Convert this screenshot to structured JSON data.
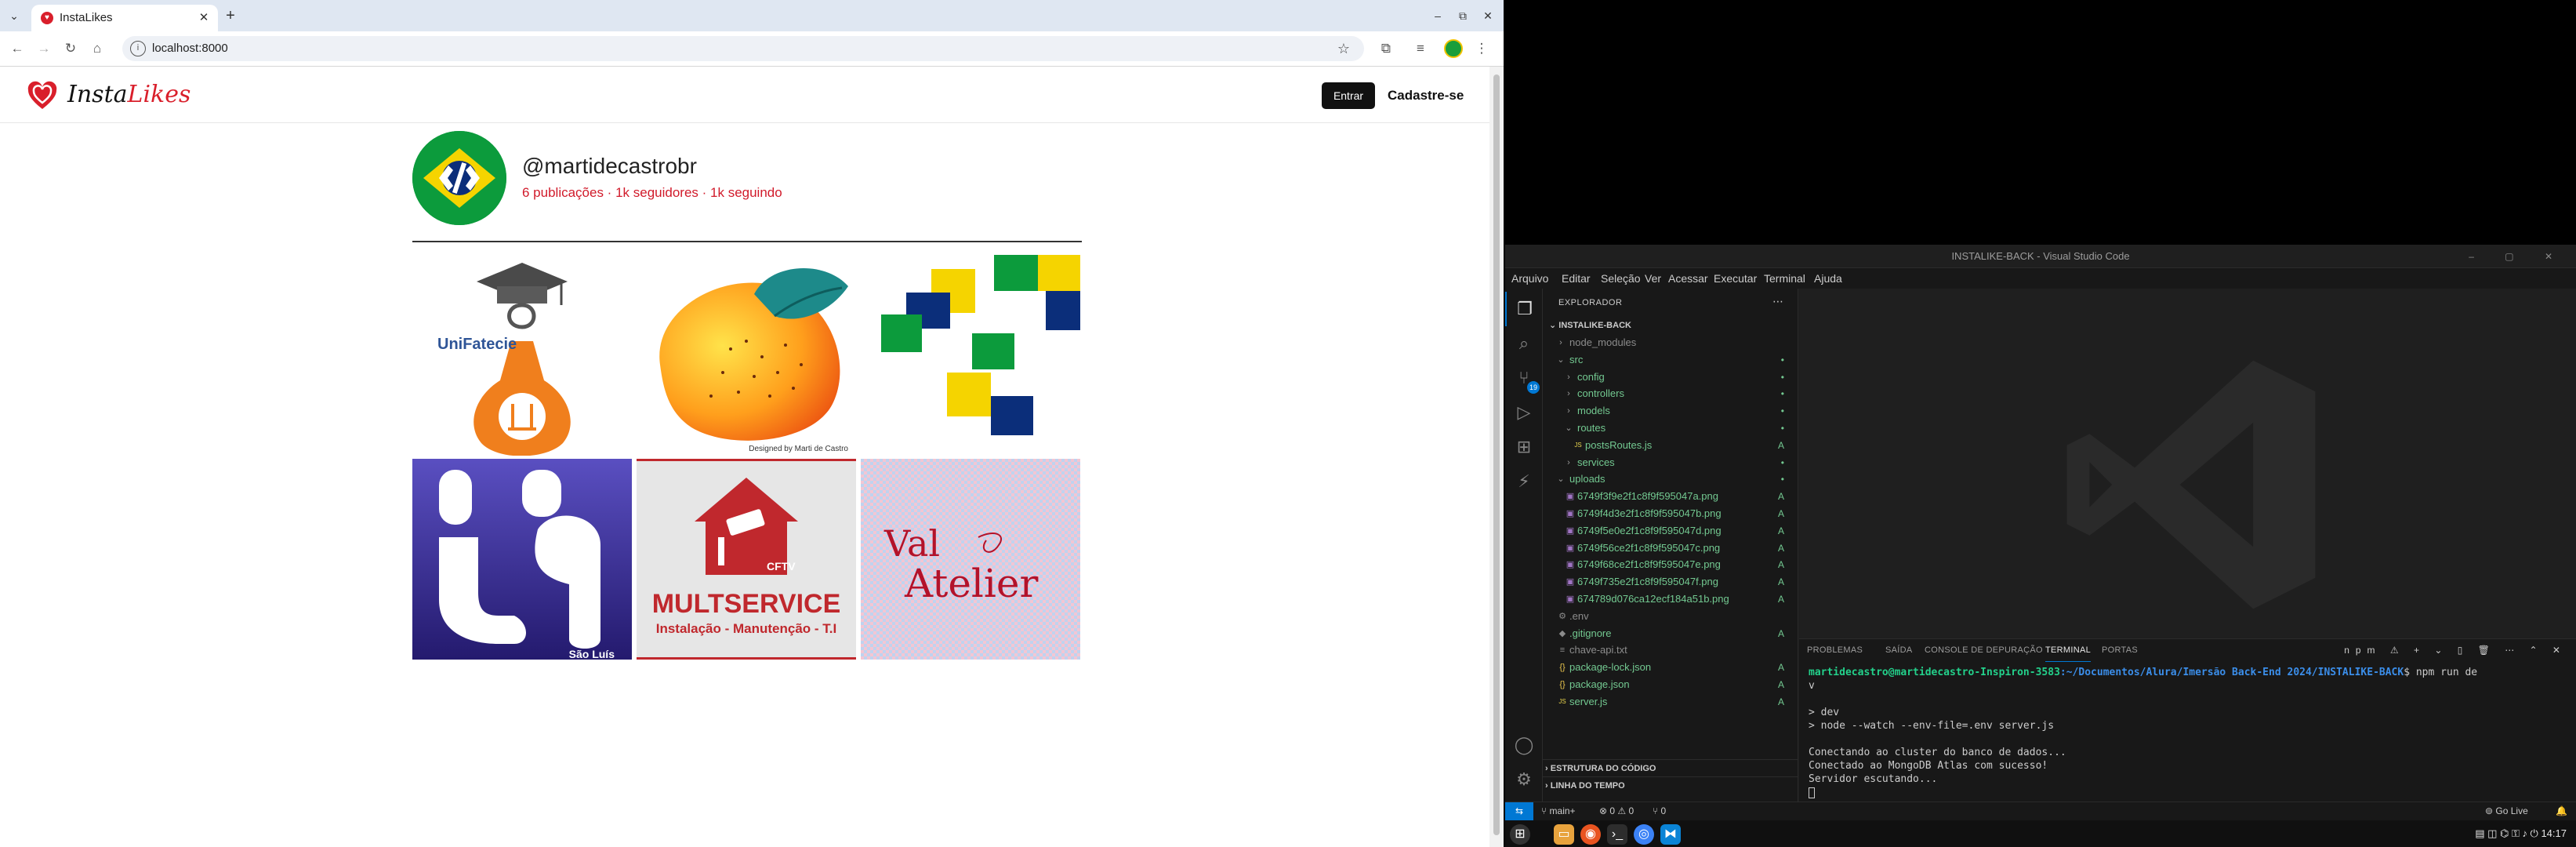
{
  "browser": {
    "tab_title": "InstaLikes",
    "url": "localhost:8000"
  },
  "site": {
    "logo_insta": "Insta",
    "logo_likes": "Likes",
    "login_label": "Entrar",
    "signup_label": "Cadastre-se",
    "profile": {
      "handle": "@martidecastrobr",
      "stats": "6 publicações · 1k seguidores · 1k seguindo"
    },
    "posts": [
      {
        "label": "UniFatecie"
      },
      {
        "label": "Designed by Marti de Castro"
      },
      {
        "label": ""
      },
      {
        "label": "São Luís"
      },
      {
        "label": "MULTSERVICE",
        "sub": "Instalação - Manutenção - T.I",
        "badge": "CFTV"
      },
      {
        "label": "Val",
        "label2": "Atelier"
      }
    ]
  },
  "vscode": {
    "title": "INSTALIKE-BACK - Visual Studio Code",
    "menu": [
      "Arquivo",
      "Editar",
      "Seleção",
      "Ver",
      "Acessar",
      "Executar",
      "Terminal",
      "Ajuda"
    ],
    "explorer_title": "EXPLORADOR",
    "project": "INSTALIKE-BACK",
    "badge": "19",
    "tree": [
      {
        "name": "node_modules",
        "indent": 1,
        "twisty": "›",
        "status": "",
        "cls": "ignored"
      },
      {
        "name": "src",
        "indent": 1,
        "twisty": "⌄",
        "status": "•",
        "cls": "added"
      },
      {
        "name": "config",
        "indent": 2,
        "twisty": "›",
        "status": "•",
        "cls": "added"
      },
      {
        "name": "controllers",
        "indent": 2,
        "twisty": "›",
        "status": "•",
        "cls": "added"
      },
      {
        "name": "models",
        "indent": 2,
        "twisty": "›",
        "status": "•",
        "cls": "added"
      },
      {
        "name": "routes",
        "indent": 2,
        "twisty": "⌄",
        "status": "•",
        "cls": "added"
      },
      {
        "name": "postsRoutes.js",
        "indent": 3,
        "twisty": "",
        "icon": "JS",
        "status": "A",
        "cls": "added"
      },
      {
        "name": "services",
        "indent": 2,
        "twisty": "›",
        "status": "•",
        "cls": "added"
      },
      {
        "name": "uploads",
        "indent": 1,
        "twisty": "⌄",
        "status": "•",
        "cls": "added"
      },
      {
        "name": "6749f3f9e2f1c8f9f595047a.png",
        "indent": 2,
        "twisty": "",
        "icon": "▣",
        "status": "A",
        "cls": "added"
      },
      {
        "name": "6749f4d3e2f1c8f9f595047b.png",
        "indent": 2,
        "twisty": "",
        "icon": "▣",
        "status": "A",
        "cls": "added"
      },
      {
        "name": "6749f5e0e2f1c8f9f595047d.png",
        "indent": 2,
        "twisty": "",
        "icon": "▣",
        "status": "A",
        "cls": "added"
      },
      {
        "name": "6749f56ce2f1c8f9f595047c.png",
        "indent": 2,
        "twisty": "",
        "icon": "▣",
        "status": "A",
        "cls": "added"
      },
      {
        "name": "6749f68ce2f1c8f9f595047e.png",
        "indent": 2,
        "twisty": "",
        "icon": "▣",
        "status": "A",
        "cls": "added"
      },
      {
        "name": "6749f735e2f1c8f9f595047f.png",
        "indent": 2,
        "twisty": "",
        "icon": "▣",
        "status": "A",
        "cls": "added"
      },
      {
        "name": "674789d076ca12ecf184a51b.png",
        "indent": 2,
        "twisty": "",
        "icon": "▣",
        "status": "A",
        "cls": "added"
      },
      {
        "name": ".env",
        "indent": 1,
        "twisty": "",
        "icon": "⚙",
        "status": "",
        "cls": "ignored"
      },
      {
        "name": ".gitignore",
        "indent": 1,
        "twisty": "",
        "icon": "◆",
        "status": "A",
        "cls": "added"
      },
      {
        "name": "chave-api.txt",
        "indent": 1,
        "twisty": "",
        "icon": "≡",
        "status": "",
        "cls": "ignored"
      },
      {
        "name": "package-lock.json",
        "indent": 1,
        "twisty": "",
        "icon": "{}",
        "status": "A",
        "cls": "added"
      },
      {
        "name": "package.json",
        "indent": 1,
        "twisty": "",
        "icon": "{}",
        "status": "A",
        "cls": "added"
      },
      {
        "name": "server.js",
        "indent": 1,
        "twisty": "",
        "icon": "JS",
        "status": "A",
        "cls": "added"
      }
    ],
    "outline": "ESTRUTURA DO CÓDIGO",
    "timeline": "LINHA DO TEMPO",
    "panel_tabs": [
      "PROBLEMAS",
      "SAÍDA",
      "CONSOLE DE DEPURAÇÃO",
      "TERMINAL",
      "PORTAS"
    ],
    "panel_tools": "npm ⚠ + ⌄ ▯ 🗑 ⋯ ⌃ ✕",
    "terminal": {
      "user": "martidecastro@martidecastro-Inspiron-3583",
      "path": ":~/Documentos/Alura/Imersão Back-End 2024/INSTALIKE-BACK",
      "cmd": "$ npm run de",
      "cmd_wrap": "v",
      "lines": [
        "",
        "> dev",
        "> node --watch --env-file=.env server.js",
        "",
        "Conectando ao cluster do banco de dados...",
        "Conectado ao MongoDB Atlas com sucesso!",
        "Servidor escutando..."
      ]
    },
    "status": {
      "branch": "main+",
      "sync": "⊗ 0 ⚠ 0",
      "ports": "⑂ 0",
      "golive": "Go Live"
    }
  },
  "taskbar": {
    "clock": "14:17"
  }
}
